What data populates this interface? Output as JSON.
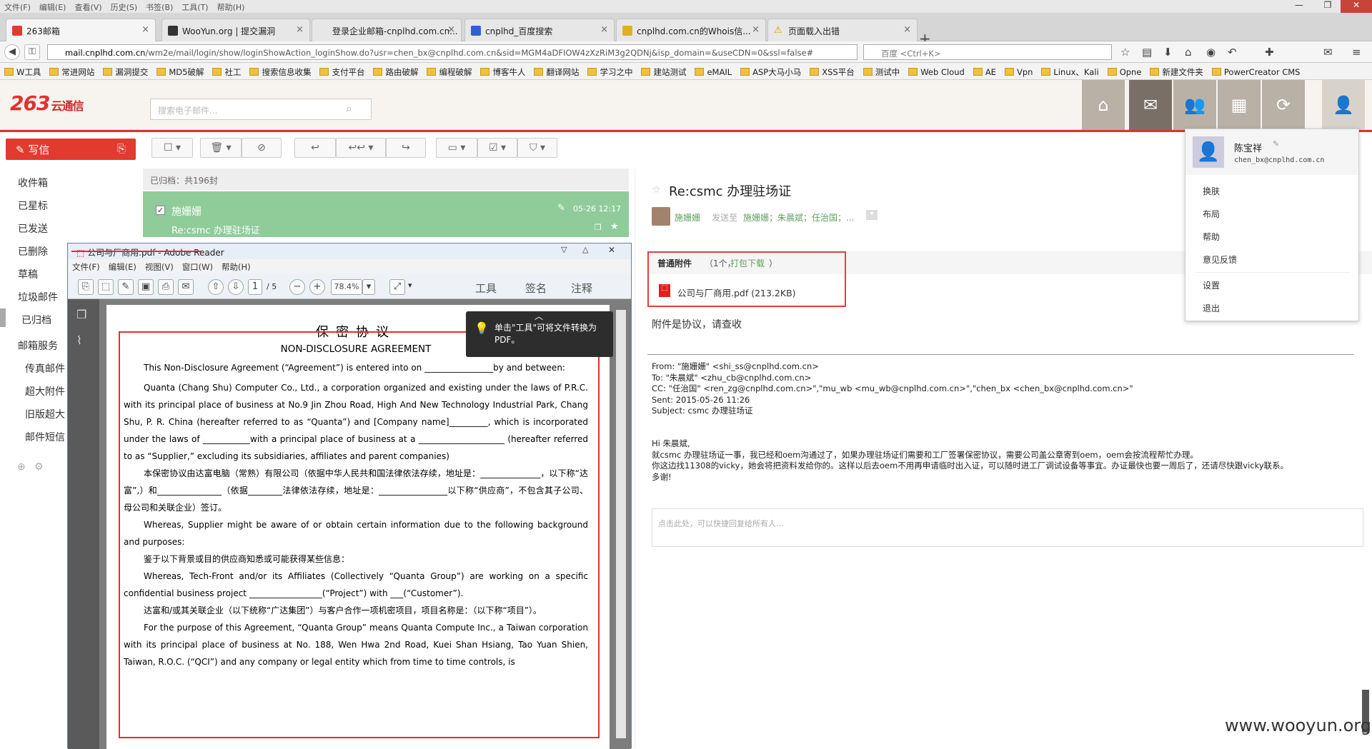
{
  "menubar": [
    "文件(F)",
    "编辑(E)",
    "查看(V)",
    "历史(S)",
    "书签(B)",
    "工具(T)",
    "帮助(H)"
  ],
  "tabs": [
    {
      "label": "263邮箱",
      "active": true
    },
    {
      "label": "WooYun.org | 提交漏洞",
      "active": false
    },
    {
      "label": "登录企业邮箱-cnplhd.com.cn...",
      "active": false
    },
    {
      "label": "cnplhd_百度搜索",
      "active": false
    },
    {
      "label": "cnplhd.com.cn的Whois信...",
      "active": false
    },
    {
      "label": "页面载入出错",
      "active": false
    }
  ],
  "address": {
    "host": "mail.cnplhd.com.cn",
    "path": "/wm2e/mail/login/show/loginShowAction_loginShow.do?usr=chen_bx@cnplhd.com.cn&sid=MGM4aDFIOW4zXzRiM3g2QDNj&isp_domain=&useCDN=0&ssl=false#",
    "search_placeholder": "百度 <Ctrl+K>"
  },
  "bookmarks": [
    "W工具",
    "常进网站",
    "漏洞提交",
    "MD5破解",
    "社工",
    "搜索信息收集",
    "支付平台",
    "路由破解",
    "编程破解",
    "博客牛人",
    "翻译网站",
    "学习之中",
    "建站测试",
    "eMAIL",
    "ASP大马小马",
    "XSS平台",
    "测试中",
    "Web Cloud",
    "AE",
    "Vpn",
    "Linux、Kali",
    "Opne",
    "新建文件夹",
    "PowerCreator CMS"
  ],
  "app": {
    "logo_main": "263",
    "logo_sub": "云通信",
    "search_placeholder": "搜索电子邮件...",
    "compose_label": "写信",
    "folders": [
      "收件箱",
      "已星标",
      "已发送",
      "已删除",
      "草稿",
      "垃圾邮件",
      "已归档",
      "邮箱服务",
      "传真邮件",
      "超大附件",
      "旧版超大",
      "邮件短信"
    ],
    "list_header": "已归档：共196封",
    "mail_item": {
      "sender": "施姗姗",
      "date": "05-26 12:17",
      "subject": "Re:csmc 办理驻场证"
    }
  },
  "reader": {
    "subject": "Re:csmc 办理驻场证",
    "sender": "施姗姗",
    "to_label": "发送至",
    "to_names": "施姗姗；朱晨斌；任治国；...",
    "attach_title": "普通附件",
    "attach_count": "（1个，",
    "attach_download": "打包下载",
    "attach_close": "）",
    "attach_file": "公司与厂商用.pdf (213.2KB)",
    "body": "附件是协议，请查收",
    "from": "From: \"施姗姗\" <shi_ss@cnplhd.com.cn>",
    "to": "To: \"朱晨斌\" <zhu_cb@cnplhd.com.cn>",
    "cc": "CC: \"任治国\" <ren_zg@cnplhd.com.cn>\",\"mu_wb <mu_wb@cnplhd.com.cn>\",\"chen_bx <chen_bx@cnplhd.com.cn>\"",
    "sent": "Sent: 2015-05-26 11:26",
    "subj_line": "Subject: csmc 办理驻场证",
    "hi1": "Hi 朱晨斌,",
    "hi2": "就csmc 办理驻场证一事，我已经和oem沟通过了，如果办理驻场证们需要和工厂签署保密协议，需要公司盖公章寄到oem，oem会按流程帮忙办理。",
    "hi3": "你这边找11308的vicky，她会将把资料发给你的。这样以后去oem不用再申请临时出入证，可以随时进工厂调试设备等事宜。办证最快也要一周后了，还请尽快跟vicky联系。",
    "hi4": "多谢!",
    "reply_placeholder": "点击此处，可以快捷回复给所有人..."
  },
  "user_menu": {
    "name": "陈宝祥",
    "email": "chen_bx@cnplhd.com.cn",
    "items": [
      "换肤",
      "布局",
      "帮助",
      "意见反馈",
      "设置",
      "退出"
    ]
  },
  "adobe": {
    "title": "公司与厂商用.pdf - Adobe Reader",
    "menu": [
      "文件(F)",
      "编辑(E)",
      "视图(V)",
      "窗口(W)",
      "帮助(H)"
    ],
    "page_num": "1",
    "page_total": "/ 5",
    "zoom": "78.4%",
    "tools": "工具",
    "sign": "签名",
    "comment": "注释",
    "tip": "单击\"工具\"可将文件转换为PDF。",
    "doc": {
      "title_cn": "保密协议",
      "title_en": "NON-DISCLOSURE AGREEMENT",
      "p1": "This Non-Disclosure Agreement (“Agreement”) is entered into on ________________by and between:",
      "p2": "Quanta (Chang Shu) Computer Co., Ltd., a corporation organized and existing under the laws of P.R.C. with its principal place of business at No.9 Jin Zhou Road, High And New Technology Industrial Park, Chang Shu, P. R. China (hereafter referred to as “Quanta”) and [Company name]_________, which is incorporated under the laws of ___________with a principal place of business at a ____________________ (hereafter referred to as “Supplier,” excluding its subsidiaries, affiliates and parent companies)",
      "p3": "本保密协议由达富电脑（常熟）有限公司（依据中华人民共和国法律依法存续，地址是：______________，以下称“达富”,）和_______________（依据________法律依法存续，地址是：________________以下称“供应商”，不包含其子公司、母公司和关联企业）签订。",
      "p4": "Whereas, Supplier might be aware of or obtain certain information due to the following background and purposes:",
      "p5": "鉴于以下背景或目的供应商知悉或可能获得某些信息：",
      "p6": "Whereas, Tech-Front and/or its Affiliates (Collectively “Quanta Group”) are working on a specific confidential business project _________________(“Project”) with ___(“Customer”).",
      "p7": "达富和/或其关联企业（以下统称“广达集团”）与客户合作一项机密项目，项目名称是：（以下称“项目”）。",
      "p8": "For the purpose of this Agreement, “Quanta Group” means Quanta Compute Inc., a Taiwan corporation with its principal place of business at No. 188, Wen Hwa 2nd Road, Kuei Shan Hsiang, Tao Yuan Shien, Taiwan, R.O.C. (“QCI”) and any company or legal entity which from time to time controls, is"
    }
  },
  "watermark": "www.wooyun.org",
  "colors": {
    "accent": "#e23a2f",
    "selected_mail": "#8fcc9a",
    "highlight_box": "#e03030"
  }
}
